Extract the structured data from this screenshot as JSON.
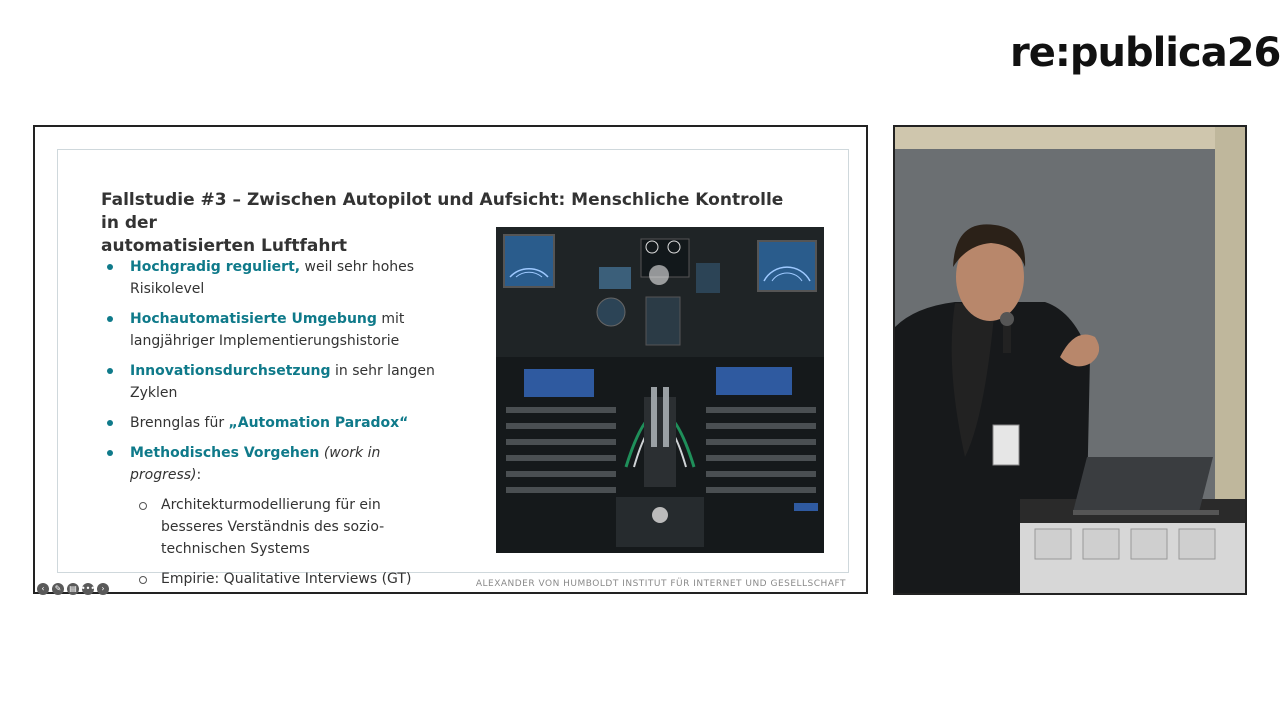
{
  "brand": {
    "logo_text": "re:publica26"
  },
  "slide": {
    "title_line1": "Fallstudie #3 – Zwischen Autopilot und Aufsicht: Menschliche Kontrolle in der",
    "title_line2": "automatisierten Luftfahrt",
    "bullets": [
      {
        "highlight": "Hochgradig reguliert,",
        "text": " weil sehr hohes Risikolevel"
      },
      {
        "highlight": "Hochautomatisierte Umgebung",
        "text": " mit langjähriger Implementierungshistorie"
      },
      {
        "highlight": "Innovationsdurchsetzung",
        "text": " in sehr langen Zyklen"
      },
      {
        "prefix": "Brennglas für ",
        "highlight": "„Automation Paradox“"
      },
      {
        "highlight": "Methodisches Vorgehen",
        "italic": " (work in progress)",
        "suffix": ":"
      }
    ],
    "sub_bullets": [
      "Architekturmodellierung für ein besseres Verständnis des sozio-technischen Systems",
      "Empirie: Qualitative Interviews (GT)"
    ],
    "footer": "ALEXANDER VON HUMBOLDT INSTITUT FÜR INTERNET UND GESELLSCHAFT",
    "image": "cockpit-photo"
  },
  "controls": {
    "icons": [
      "prev-icon",
      "pen-icon",
      "slides-icon",
      "menu-icon",
      "next-icon"
    ],
    "glyphs": [
      "‹",
      "✎",
      "▤",
      "•••",
      "›"
    ]
  },
  "camera": {
    "image": "speaker-video-feed"
  },
  "colors": {
    "accent": "#0f7a8a",
    "text": "#333333",
    "footer": "#8a8a8a"
  }
}
